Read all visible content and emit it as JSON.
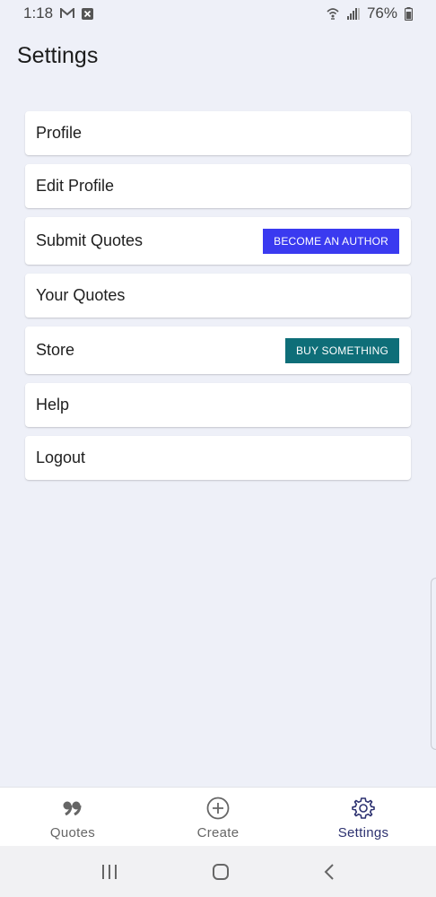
{
  "status_bar": {
    "time": "1:18",
    "battery": "76%"
  },
  "page": {
    "title": "Settings"
  },
  "menu": {
    "items": [
      {
        "label": "Profile"
      },
      {
        "label": "Edit Profile"
      },
      {
        "label": "Submit Quotes",
        "button": "BECOME AN AUTHOR",
        "button_color": "#3a3af0"
      },
      {
        "label": "Your Quotes"
      },
      {
        "label": "Store",
        "button": "BUY SOMETHING",
        "button_color": "#0e6e78"
      },
      {
        "label": "Help"
      },
      {
        "label": "Logout"
      }
    ]
  },
  "bottom_nav": {
    "items": [
      {
        "label": "Quotes",
        "icon": "quote-icon",
        "active": false
      },
      {
        "label": "Create",
        "icon": "plus-circle-icon",
        "active": false
      },
      {
        "label": "Settings",
        "icon": "gear-icon",
        "active": true
      }
    ]
  },
  "system_nav": {
    "icons": [
      "recent-apps-icon",
      "home-icon",
      "back-icon"
    ]
  }
}
